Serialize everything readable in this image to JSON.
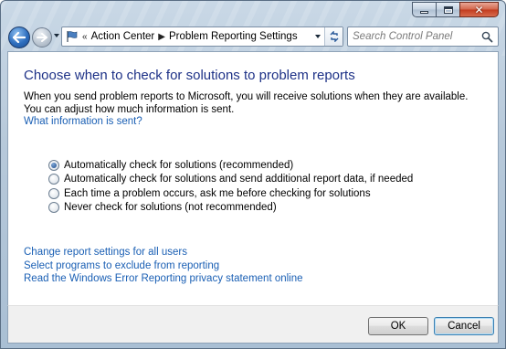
{
  "window": {
    "caption_buttons": {
      "minimize": "minimize",
      "maximize": "maximize",
      "close": "close"
    }
  },
  "nav": {
    "back_icon": "back-arrow-icon",
    "forward_icon": "forward-arrow-icon",
    "address_icon": "action-center-flag-icon",
    "breadcrumb": [
      "Action Center",
      "Problem Reporting Settings"
    ],
    "separator": "▶",
    "leading_chevron": "«"
  },
  "search": {
    "placeholder": "Search Control Panel"
  },
  "main": {
    "title": "Choose when to check for solutions to problem reports",
    "description": "When you send problem reports to Microsoft, you will receive solutions when they are available. You can adjust how much information is sent.",
    "info_link": "What information is sent?",
    "options": [
      {
        "label": "Automatically check for solutions (recommended)",
        "selected": true
      },
      {
        "label": "Automatically check for solutions and send additional report data, if needed",
        "selected": false
      },
      {
        "label": "Each time a problem occurs, ask me before checking for solutions",
        "selected": false
      },
      {
        "label": "Never check for solutions (not recommended)",
        "selected": false
      }
    ],
    "links": [
      "Change report settings for all users",
      "Select programs to exclude from reporting",
      "Read the Windows Error Reporting privacy statement online"
    ]
  },
  "footer": {
    "ok_label": "OK",
    "cancel_label": "Cancel"
  },
  "colors": {
    "title": "#1e3287",
    "link": "#1a5fb4",
    "accent": "#3c7fb1"
  }
}
